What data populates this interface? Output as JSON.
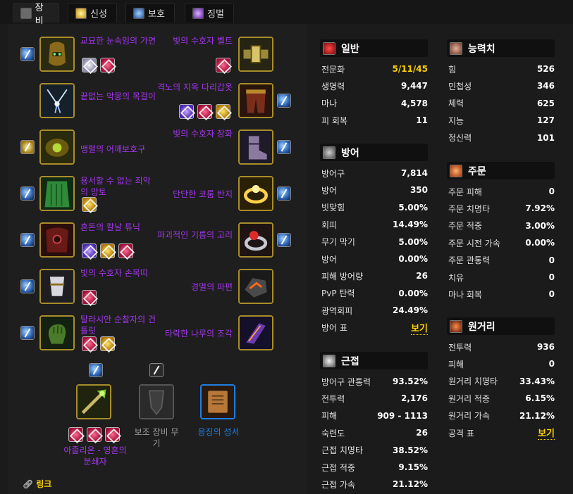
{
  "tabs": [
    {
      "label": "장비",
      "icon": "armor-icon"
    },
    {
      "label": "신성",
      "icon": "holy-icon"
    },
    {
      "label": "보호",
      "icon": "shield-icon"
    },
    {
      "label": "징벌",
      "icon": "retribution-icon"
    }
  ],
  "left_items": [
    {
      "name": "교묘한 눈속임의 가면",
      "color": "#a335ee"
    },
    {
      "name": "끝없는 악몽의 목걸이",
      "color": "#a335ee"
    },
    {
      "name": "맹렬의 어깨보호구",
      "color": "#a335ee"
    },
    {
      "name": "용서할 수 없는 죄악의 망토",
      "color": "#a335ee"
    },
    {
      "name": "혼돈의 칼날 튜닉",
      "color": "#a335ee"
    },
    {
      "name": "빛의 수호자 손목띠",
      "color": "#a335ee"
    },
    {
      "name": "탈라시안 순찰자의 건틀릿",
      "color": "#a335ee"
    }
  ],
  "right_items": [
    {
      "name": "빛의 수호자 벨트",
      "color": "#a335ee"
    },
    {
      "name": "격노의 지옥 다리갑옷",
      "color": "#a335ee"
    },
    {
      "name": "빛의 수호자 장화",
      "color": "#a335ee"
    },
    {
      "name": "단단한 코룸 반지",
      "color": "#a335ee"
    },
    {
      "name": "파괴적인 기름의 고리",
      "color": "#a335ee"
    },
    {
      "name": "경멸의 파편",
      "color": "#a335ee"
    },
    {
      "name": "타락한 나루의 조각",
      "color": "#a335ee"
    }
  ],
  "weapons": [
    {
      "name": "아졸리온 - 영혼의 분쇄자",
      "color": "#a335ee"
    },
    {
      "name": "보조 장비 무기",
      "color": "#9d9d9d"
    },
    {
      "name": "응징의 성서",
      "color": "#1f7fe0"
    }
  ],
  "link_label": "링크",
  "general": {
    "title": "일반",
    "rows": [
      {
        "label": "전문화",
        "value": "5/11/45"
      },
      {
        "label": "생명력",
        "value": "9,447"
      },
      {
        "label": "마나",
        "value": "4,578"
      },
      {
        "label": "피 회복",
        "value": "11"
      }
    ]
  },
  "defense": {
    "title": "방어",
    "rows": [
      {
        "label": "방어구",
        "value": "7,814"
      },
      {
        "label": "방어",
        "value": "350"
      },
      {
        "label": "빗맞힘",
        "value": "5.00%"
      },
      {
        "label": "회피",
        "value": "14.49%"
      },
      {
        "label": "무기 막기",
        "value": "5.00%"
      },
      {
        "label": "방어",
        "value": "0.00%"
      },
      {
        "label": "피해 방어량",
        "value": "26"
      },
      {
        "label": "PvP 탄력",
        "value": "0.00%"
      },
      {
        "label": "광역회피",
        "value": "24.49%"
      },
      {
        "label": "방어 표",
        "value": "보기"
      }
    ]
  },
  "melee": {
    "title": "근접",
    "rows": [
      {
        "label": "방어구 관통력",
        "value": "93.52%"
      },
      {
        "label": "전투력",
        "value": "2,176"
      },
      {
        "label": "피해",
        "value": "909 - 1113"
      },
      {
        "label": "숙련도",
        "value": "26"
      },
      {
        "label": "근접 치명타",
        "value": "38.52%"
      },
      {
        "label": "근접 적중",
        "value": "9.15%"
      },
      {
        "label": "근접 가속",
        "value": "21.12%"
      }
    ]
  },
  "attributes": {
    "title": "능력치",
    "rows": [
      {
        "label": "힘",
        "value": "526"
      },
      {
        "label": "민첩성",
        "value": "346"
      },
      {
        "label": "체력",
        "value": "625"
      },
      {
        "label": "지능",
        "value": "127"
      },
      {
        "label": "정신력",
        "value": "101"
      }
    ]
  },
  "spell": {
    "title": "주문",
    "rows": [
      {
        "label": "주문 피해",
        "value": "0"
      },
      {
        "label": "주문 치명타",
        "value": "7.92%"
      },
      {
        "label": "주문 적중",
        "value": "3.00%"
      },
      {
        "label": "주문 시전 가속",
        "value": "0.00%"
      },
      {
        "label": "주문 관통력",
        "value": "0"
      },
      {
        "label": "치유",
        "value": "0"
      },
      {
        "label": "마나 회복",
        "value": "0"
      }
    ]
  },
  "ranged": {
    "title": "원거리",
    "rows": [
      {
        "label": "전투력",
        "value": "936"
      },
      {
        "label": "피해",
        "value": "0"
      },
      {
        "label": "원거리 치명타",
        "value": "33.43%"
      },
      {
        "label": "원거리 적중",
        "value": "6.15%"
      },
      {
        "label": "원거리 가속",
        "value": "21.12%"
      },
      {
        "label": "공격 표",
        "value": "보기"
      }
    ]
  }
}
